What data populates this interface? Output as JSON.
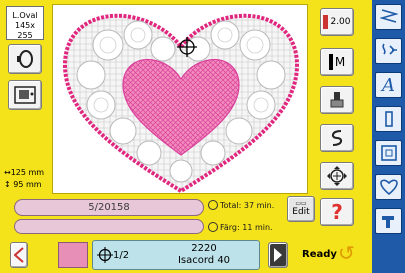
{
  "hoop": {
    "label_line1": "L.Oval",
    "label_line2": "145x 255"
  },
  "design_size": {
    "width": "125 mm",
    "height": "95 mm"
  },
  "stitch_counter": "5/20158",
  "time_info": {
    "total": "Total: 37 min.",
    "color": "Färg: 11 min."
  },
  "edit_button": "Edit",
  "right_toolbar": {
    "speed_value": "2.00",
    "mirror_label": "M"
  },
  "color_bar": {
    "position": "1/2",
    "thread_number": "2220",
    "thread_name": "Isacord 40",
    "swatch_color": "#e88fb8"
  },
  "status": {
    "ready_label": "Ready"
  },
  "icons": {
    "back": "left-arrow-icon",
    "next": "right-arrow-icon",
    "crosshair": "crosshair-icon",
    "help": "question-icon"
  }
}
